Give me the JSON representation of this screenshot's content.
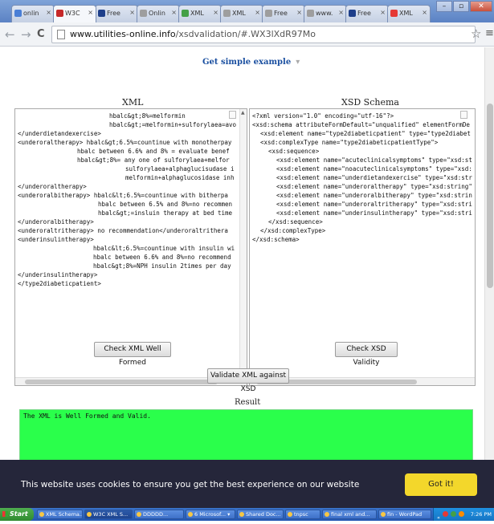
{
  "browser": {
    "tabs": [
      {
        "label": "onlin",
        "icon_color": "#4a7fd6",
        "active": false
      },
      {
        "label": "W3C",
        "icon_color": "#c62828",
        "active": true
      },
      {
        "label": "Free",
        "icon_color": "#1e3f8a",
        "active": false
      },
      {
        "label": "Onlin",
        "icon_color": "#9e9e9e",
        "active": false
      },
      {
        "label": "XML",
        "icon_color": "#43a047",
        "active": false
      },
      {
        "label": "XML",
        "icon_color": "#9e9e9e",
        "active": false
      },
      {
        "label": "Free",
        "icon_color": "#9e9e9e",
        "active": false
      },
      {
        "label": "www.",
        "icon_color": "#9e9e9e",
        "active": false
      },
      {
        "label": "Free",
        "icon_color": "#1e3f8a",
        "active": false
      },
      {
        "label": "XML",
        "icon_color": "#e53935",
        "active": false
      }
    ],
    "tab_close_glyph": "×",
    "url_host": "www.utilities-online.info",
    "url_path": "/xsdvalidation/#.WX3lXdR97Mo",
    "back_glyph": "←",
    "forward_glyph": "→",
    "reload_glyph": "C",
    "star_glyph": "☆",
    "menu_glyph": "≡",
    "window_buttons": {
      "minimize": "–",
      "maximize": "▫",
      "close": "✕"
    }
  },
  "page": {
    "get_example_label": "Get simple example",
    "xml_title": "XML",
    "xsd_title": "XSD Schema",
    "xml_lines": [
      {
        "indent": 114,
        "text": "hbalc&gt;8%=melformin"
      },
      {
        "indent": 114,
        "text": "hbalc&gt;=melformin+sulforylaea=avo"
      },
      {
        "indent": 0,
        "text": "</underdietandexercise>"
      },
      {
        "indent": 0,
        "text": "<underoraltherapy> hbalc&gt;6.5%=countinue with monotherpay"
      },
      {
        "indent": 74,
        "text": "hbalc between 6.6% and 8% = evaluate benef"
      },
      {
        "indent": 74,
        "text": "hbalc&gt;8%= any one of sulforylaea+melfor"
      },
      {
        "indent": 134,
        "text": "sulforylaea+alphaglucisudase i"
      },
      {
        "indent": 134,
        "text": "melformin+alphaglucosidase inh"
      },
      {
        "indent": 0,
        "text": "</underoraltherapy>"
      },
      {
        "indent": 0,
        "text": "<underoralbitherapy> hbalc&lt;6.5%=countinue with bitherpa"
      },
      {
        "indent": 100,
        "text": "hbalc between 6.5% and 8%=no recommen"
      },
      {
        "indent": 100,
        "text": "hbalc&gt;=insluin therapy at bed time"
      },
      {
        "indent": 0,
        "text": "</underoralbitherapy>"
      },
      {
        "indent": 0,
        "text": "<underoraltritherapy> no recommendation</underoraltrithera"
      },
      {
        "indent": 0,
        "text": "<underinsulintherapy>"
      },
      {
        "indent": 94,
        "text": "hbalc&lt;6.5%=countinue with insulin wi"
      },
      {
        "indent": 94,
        "text": "hbalc between 6.6% and 8%=no recommend"
      },
      {
        "indent": 94,
        "text": "hbalc&gt;8%=NPH insulin 2times per day"
      },
      {
        "indent": 0,
        "text": "</underinsulintherapy>"
      },
      {
        "indent": 0,
        "text": "</type2diabeticpatient>"
      }
    ],
    "xsd_lines": [
      {
        "indent": 0,
        "text": "<?xml version=\"1.0\" encoding=\"utf-16\"?>"
      },
      {
        "indent": 0,
        "text": "<xsd:schema attributeFormDefault=\"unqualified\" elementFormDe"
      },
      {
        "indent": 10,
        "text": "<xsd:element name=\"type2diabeticpatient\" type=\"type2diabet"
      },
      {
        "indent": 10,
        "text": "<xsd:complexType name=\"type2diabeticpatientType\">"
      },
      {
        "indent": 20,
        "text": "<xsd:sequence>"
      },
      {
        "indent": 30,
        "text": "<xsd:element name=\"acuteclinicalsymptoms\" type=\"xsd:st"
      },
      {
        "indent": 30,
        "text": "<xsd:element name=\"noacuteclinicalsymptoms\" type=\"xsd:"
      },
      {
        "indent": 30,
        "text": "<xsd:element name=\"underdietandexercise\" type=\"xsd:str"
      },
      {
        "indent": 30,
        "text": "<xsd:element name=\"underoraltherapy\" type=\"xsd:string\""
      },
      {
        "indent": 30,
        "text": "<xsd:element name=\"underoralbitherapy\" type=\"xsd:strin"
      },
      {
        "indent": 30,
        "text": "<xsd:element name=\"underoraltritherapy\" type=\"xsd:stri"
      },
      {
        "indent": 30,
        "text": "<xsd:element name=\"underinsulintherapy\" type=\"xsd:stri"
      },
      {
        "indent": 20,
        "text": "</xsd:sequence>"
      },
      {
        "indent": 10,
        "text": "</xsd:complexType>"
      },
      {
        "indent": 0,
        "text": "</xsd:schema>"
      }
    ],
    "check_xml_button": "Check XML Well Formed",
    "check_xsd_button": "Check XSD Validity",
    "validate_button": "Validate XML against XSD",
    "result_label": "Result",
    "result_text": "The XML is Well Formed and Valid.",
    "result_color": "#2aff4b"
  },
  "cookie_banner": {
    "message": "This website uses cookies to ensure you get the best experience on our website",
    "button": "Got it!",
    "button_color": "#f3d72b",
    "background": "#25263a"
  },
  "taskbar": {
    "start_label": "Start",
    "items": [
      {
        "label": "XML Schema...",
        "active": false
      },
      {
        "label": "W3C XML S...",
        "active": true
      },
      {
        "label": "DDDDD...",
        "active": false
      },
      {
        "label": "6 Microsof... ▾",
        "active": false
      },
      {
        "label": "Shared Doc...",
        "active": false
      },
      {
        "label": "tnpsc",
        "active": false
      },
      {
        "label": "final xml and...",
        "active": false
      },
      {
        "label": "fin - WordPad",
        "active": false
      }
    ],
    "clock": "7:26 PM",
    "tray_prefix": "«"
  }
}
